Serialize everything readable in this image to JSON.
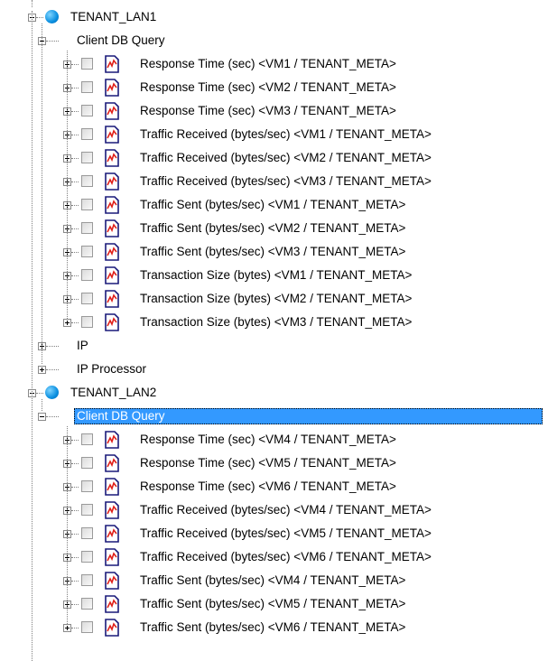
{
  "tree": {
    "nodes": [
      {
        "kind": "group",
        "label": "TENANT_LAN1",
        "expanded": true,
        "children": [
          {
            "kind": "category",
            "label": "Client DB Query",
            "expanded": true,
            "selected": false,
            "metrics": [
              "Response Time (sec) <VM1 / TENANT_META>",
              "Response Time (sec) <VM2 / TENANT_META>",
              "Response Time (sec) <VM3 / TENANT_META>",
              "Traffic Received (bytes/sec) <VM1 / TENANT_META>",
              "Traffic Received (bytes/sec) <VM2 / TENANT_META>",
              "Traffic Received (bytes/sec) <VM3 / TENANT_META>",
              "Traffic Sent (bytes/sec) <VM1 / TENANT_META>",
              "Traffic Sent (bytes/sec) <VM2 / TENANT_META>",
              "Traffic Sent (bytes/sec) <VM3 / TENANT_META>",
              "Transaction Size (bytes) <VM1 / TENANT_META>",
              "Transaction Size (bytes) <VM2 / TENANT_META>",
              "Transaction Size (bytes) <VM3 / TENANT_META>"
            ]
          },
          {
            "kind": "category",
            "label": "IP",
            "expanded": false,
            "selected": false,
            "metrics": []
          },
          {
            "kind": "category",
            "label": "IP Processor",
            "expanded": false,
            "selected": false,
            "metrics": []
          }
        ]
      },
      {
        "kind": "group",
        "label": "TENANT_LAN2",
        "expanded": true,
        "children": [
          {
            "kind": "category",
            "label": "Client DB Query",
            "expanded": true,
            "selected": true,
            "metrics": [
              "Response Time (sec) <VM4 / TENANT_META>",
              "Response Time (sec) <VM5 / TENANT_META>",
              "Response Time (sec) <VM6 / TENANT_META>",
              "Traffic Received (bytes/sec) <VM4 / TENANT_META>",
              "Traffic Received (bytes/sec) <VM5 / TENANT_META>",
              "Traffic Received (bytes/sec) <VM6 / TENANT_META>",
              "Traffic Sent (bytes/sec) <VM4 / TENANT_META>",
              "Traffic Sent (bytes/sec) <VM5 / TENANT_META>",
              "Traffic Sent (bytes/sec) <VM6 / TENANT_META>"
            ]
          }
        ]
      }
    ]
  },
  "icons": {
    "group": "network-globe-icon",
    "metric": "chart-document-icon",
    "checkbox": "checkbox-icon"
  },
  "colors": {
    "selection": "#3399ff",
    "globe": "#0a8fe0",
    "chart_line": "#e0201a",
    "chart_border": "#1a1a7a"
  }
}
